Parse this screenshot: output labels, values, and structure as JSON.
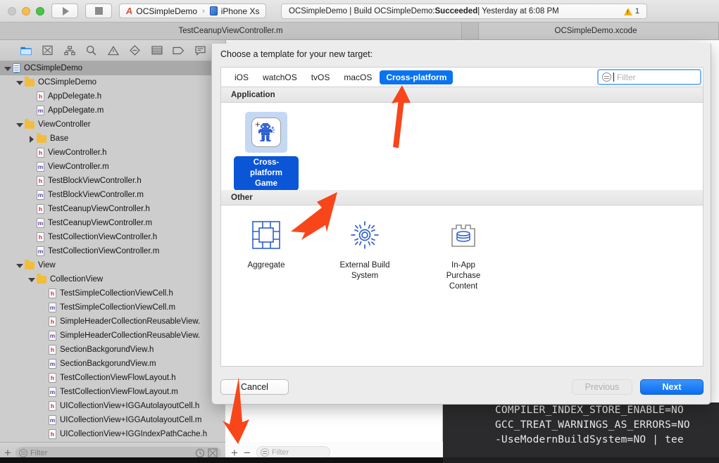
{
  "window": {
    "traffic_lights": [
      "close",
      "minimize",
      "zoom"
    ],
    "run_button": "run-icon",
    "stop_button": "stop-icon",
    "scheme_project": "OCSimpleDemo",
    "scheme_separator": "›",
    "scheme_device": "iPhone Xs",
    "status_prefix": "OCSimpleDemo | Build OCSimpleDemo: ",
    "status_result": "Succeeded",
    "status_suffix": " | Yesterday at 6:08 PM",
    "warning_count": "1"
  },
  "tabs": {
    "editor_tab": "TestCeanupViewController.m",
    "right_tab": "OCSimpleDemo.xcode"
  },
  "navigator": {
    "icons": [
      {
        "name": "folder-icon",
        "active": true
      },
      {
        "name": "source-control-icon",
        "active": false
      },
      {
        "name": "symbol-hierarchy-icon",
        "active": false
      },
      {
        "name": "search-icon",
        "active": false
      },
      {
        "name": "warning-triangle-icon",
        "active": false
      },
      {
        "name": "test-diamond-icon",
        "active": false
      },
      {
        "name": "debug-list-icon",
        "active": false
      },
      {
        "name": "breakpoint-tag-icon",
        "active": false
      },
      {
        "name": "report-bubble-icon",
        "active": false
      }
    ],
    "tree": [
      {
        "label": "OCSimpleDemo",
        "indent": 0,
        "kind": "project",
        "disc": "open",
        "selected": true
      },
      {
        "label": "OCSimpleDemo",
        "indent": 1,
        "kind": "folder",
        "disc": "open",
        "selected": false
      },
      {
        "label": "AppDelegate.h",
        "indent": 2,
        "kind": "h",
        "disc": "none",
        "selected": false
      },
      {
        "label": "AppDelegate.m",
        "indent": 2,
        "kind": "m",
        "disc": "none",
        "selected": false
      },
      {
        "label": "ViewController",
        "indent": 1,
        "kind": "folder",
        "disc": "open",
        "selected": false
      },
      {
        "label": "Base",
        "indent": 2,
        "kind": "folder",
        "disc": "closed",
        "selected": false
      },
      {
        "label": "ViewController.h",
        "indent": 2,
        "kind": "h",
        "disc": "none",
        "selected": false
      },
      {
        "label": "ViewController.m",
        "indent": 2,
        "kind": "m",
        "disc": "none",
        "selected": false
      },
      {
        "label": "TestBlockViewController.h",
        "indent": 2,
        "kind": "h",
        "disc": "none",
        "selected": false
      },
      {
        "label": "TestBlockViewController.m",
        "indent": 2,
        "kind": "m",
        "disc": "none",
        "selected": false
      },
      {
        "label": "TestCeanupViewController.h",
        "indent": 2,
        "kind": "h",
        "disc": "none",
        "selected": false
      },
      {
        "label": "TestCeanupViewController.m",
        "indent": 2,
        "kind": "m",
        "disc": "none",
        "selected": false
      },
      {
        "label": "TestCollectionViewController.h",
        "indent": 2,
        "kind": "h",
        "disc": "none",
        "selected": false
      },
      {
        "label": "TestCollectionViewController.m",
        "indent": 2,
        "kind": "m",
        "disc": "none",
        "selected": false
      },
      {
        "label": "View",
        "indent": 1,
        "kind": "folder",
        "disc": "open",
        "selected": false
      },
      {
        "label": "CollectionView",
        "indent": 2,
        "kind": "folder",
        "disc": "open",
        "selected": false
      },
      {
        "label": "TestSimpleCollectionViewCell.h",
        "indent": 3,
        "kind": "h",
        "disc": "none",
        "selected": false
      },
      {
        "label": "TestSimpleCollectionViewCell.m",
        "indent": 3,
        "kind": "m",
        "disc": "none",
        "selected": false
      },
      {
        "label": "SimpleHeaderCollectionReusableView.",
        "indent": 3,
        "kind": "h",
        "disc": "none",
        "selected": false
      },
      {
        "label": "SimpleHeaderCollectionReusableView.",
        "indent": 3,
        "kind": "m",
        "disc": "none",
        "selected": false
      },
      {
        "label": "SectionBackgorundView.h",
        "indent": 3,
        "kind": "h",
        "disc": "none",
        "selected": false
      },
      {
        "label": "SectionBackgorundView.m",
        "indent": 3,
        "kind": "m",
        "disc": "none",
        "selected": false
      },
      {
        "label": "TestCollectionViewFlowLayout.h",
        "indent": 3,
        "kind": "h",
        "disc": "none",
        "selected": false
      },
      {
        "label": "TestCollectionViewFlowLayout.m",
        "indent": 3,
        "kind": "m",
        "disc": "none",
        "selected": false
      },
      {
        "label": "UICollectionView+IGGAutolayoutCell.h",
        "indent": 3,
        "kind": "h",
        "disc": "none",
        "selected": false
      },
      {
        "label": "UICollectionView+IGGAutolayoutCell.m",
        "indent": 3,
        "kind": "m",
        "disc": "none",
        "selected": false
      },
      {
        "label": "UICollectionView+IGGIndexPathCache.h",
        "indent": 3,
        "kind": "h",
        "disc": "none",
        "selected": false
      }
    ],
    "footer": {
      "add_label": "+",
      "filter_placeholder": "Filter",
      "recent_icon": "clock-icon",
      "source-control_icon": "sourcecontrol-icon"
    }
  },
  "bottom_panel": {
    "add_label": "+",
    "remove_label": "−",
    "filter_placeholder": "Filter"
  },
  "console": {
    "lines": [
      "COMPILER_INDEX_STORE_ENABLE=NO",
      "GCC_TREAT_WARNINGS_AS_ERRORS=NO",
      "-UseModernBuildSystem=NO  |  tee"
    ]
  },
  "sheet": {
    "title": "Choose a template for your new target:",
    "platform_tabs": [
      {
        "label": "iOS",
        "active": false
      },
      {
        "label": "watchOS",
        "active": false
      },
      {
        "label": "tvOS",
        "active": false
      },
      {
        "label": "macOS",
        "active": false
      },
      {
        "label": "Cross-platform",
        "active": true
      }
    ],
    "filter_placeholder": "Filter",
    "sections": [
      {
        "heading": "Application",
        "templates": [
          {
            "label": "Cross-platform\nGame",
            "icon": "game-robot-icon",
            "selected": true
          }
        ]
      },
      {
        "heading": "Other",
        "templates": [
          {
            "label": "Aggregate",
            "icon": "aggregate-icon",
            "selected": false
          },
          {
            "label": "External Build\nSystem",
            "icon": "gear-icon",
            "selected": false
          },
          {
            "label": "In-App Purchase\nContent",
            "icon": "iap-content-icon",
            "selected": false
          }
        ]
      }
    ],
    "buttons": {
      "cancel": "Cancel",
      "previous": "Previous",
      "next": "Next"
    }
  },
  "annotations": {
    "arrow_color": "#f8461a",
    "arrows": [
      {
        "name": "arrow-to-cross-platform-tab",
        "points_to": "Cross-platform"
      },
      {
        "name": "arrow-to-aggregate-template",
        "points_to": "Aggregate"
      },
      {
        "name": "arrow-to-add-target-button",
        "points_to": "+"
      }
    ]
  },
  "colors": {
    "accent_blue": "#0a74f0",
    "selection_blue": "#0a56d6",
    "arrow_orange": "#f8461a",
    "warning_yellow": "#f2b51c"
  }
}
